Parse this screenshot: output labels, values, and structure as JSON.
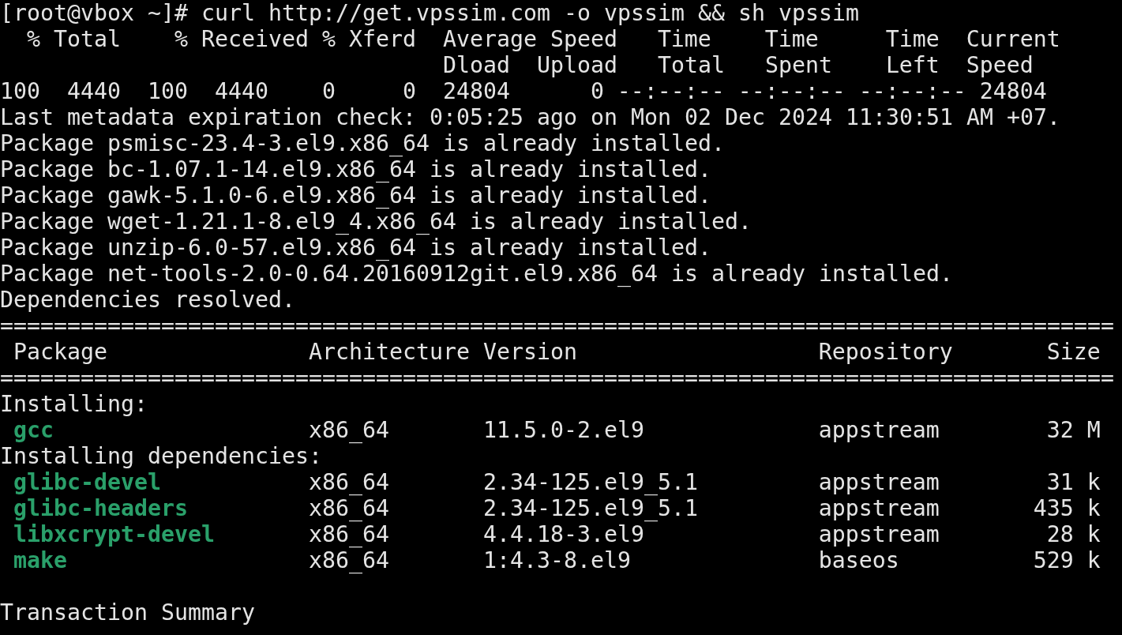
{
  "prompt": {
    "text": "[root@vbox ~]#",
    "command": "curl http://get.vpssim.com -o vpssim && sh vpssim"
  },
  "progress_meter": {
    "header_rows": [
      [
        "% Total",
        "% Received",
        "% Xferd",
        "Average Speed",
        "Time",
        "Time",
        "Time",
        "Current"
      ],
      [
        "Dload",
        "Upload",
        "Total",
        "Spent",
        "Left",
        "Speed"
      ]
    ],
    "values": [
      "100",
      "4440",
      "100",
      "4440",
      "0",
      "0",
      "24804",
      "0",
      "--:--:--",
      "--:--:--",
      "--:--:--",
      "24804"
    ]
  },
  "messages": [
    "Last metadata expiration check: 0:05:25 ago on Mon 02 Dec 2024 11:30:51 AM +07.",
    "Package psmisc-23.4-3.el9.x86_64 is already installed.",
    "Package bc-1.07.1-14.el9.x86_64 is already installed.",
    "Package gawk-5.1.0-6.el9.x86_64 is already installed.",
    "Package wget-1.21.1-8.el9_4.x86_64 is already installed.",
    "Package unzip-6.0-57.el9.x86_64 is already installed.",
    "Package net-tools-2.0-0.64.20160912git.el9.x86_64 is already installed.",
    "Dependencies resolved."
  ],
  "transaction_table": {
    "top_rule": "===================================================================================",
    "columns": [
      "Package",
      "Architecture",
      "Version",
      "Repository",
      "Size"
    ],
    "header_rule": "===================================================================================",
    "groups": [
      {
        "title": "Installing:",
        "rows": [
          {
            "package": "gcc",
            "architecture": "x86_64",
            "version": "11.5.0-2.el9",
            "repository": "appstream",
            "size": "32 M"
          }
        ]
      },
      {
        "title": "Installing dependencies:",
        "rows": [
          {
            "package": "glibc-devel",
            "architecture": "x86_64",
            "version": "2.34-125.el9_5.1",
            "repository": "appstream",
            "size": "31 k"
          },
          {
            "package": "glibc-headers",
            "architecture": "x86_64",
            "version": "2.34-125.el9_5.1",
            "repository": "appstream",
            "size": "435 k"
          },
          {
            "package": "libxcrypt-devel",
            "architecture": "x86_64",
            "version": "4.4.18-3.el9",
            "repository": "appstream",
            "size": "28 k"
          },
          {
            "package": "make",
            "architecture": "x86_64",
            "version": "1:4.3-8.el9",
            "repository": "baseos",
            "size": "529 k"
          }
        ]
      }
    ]
  },
  "summary_heading": "Transaction Summary"
}
